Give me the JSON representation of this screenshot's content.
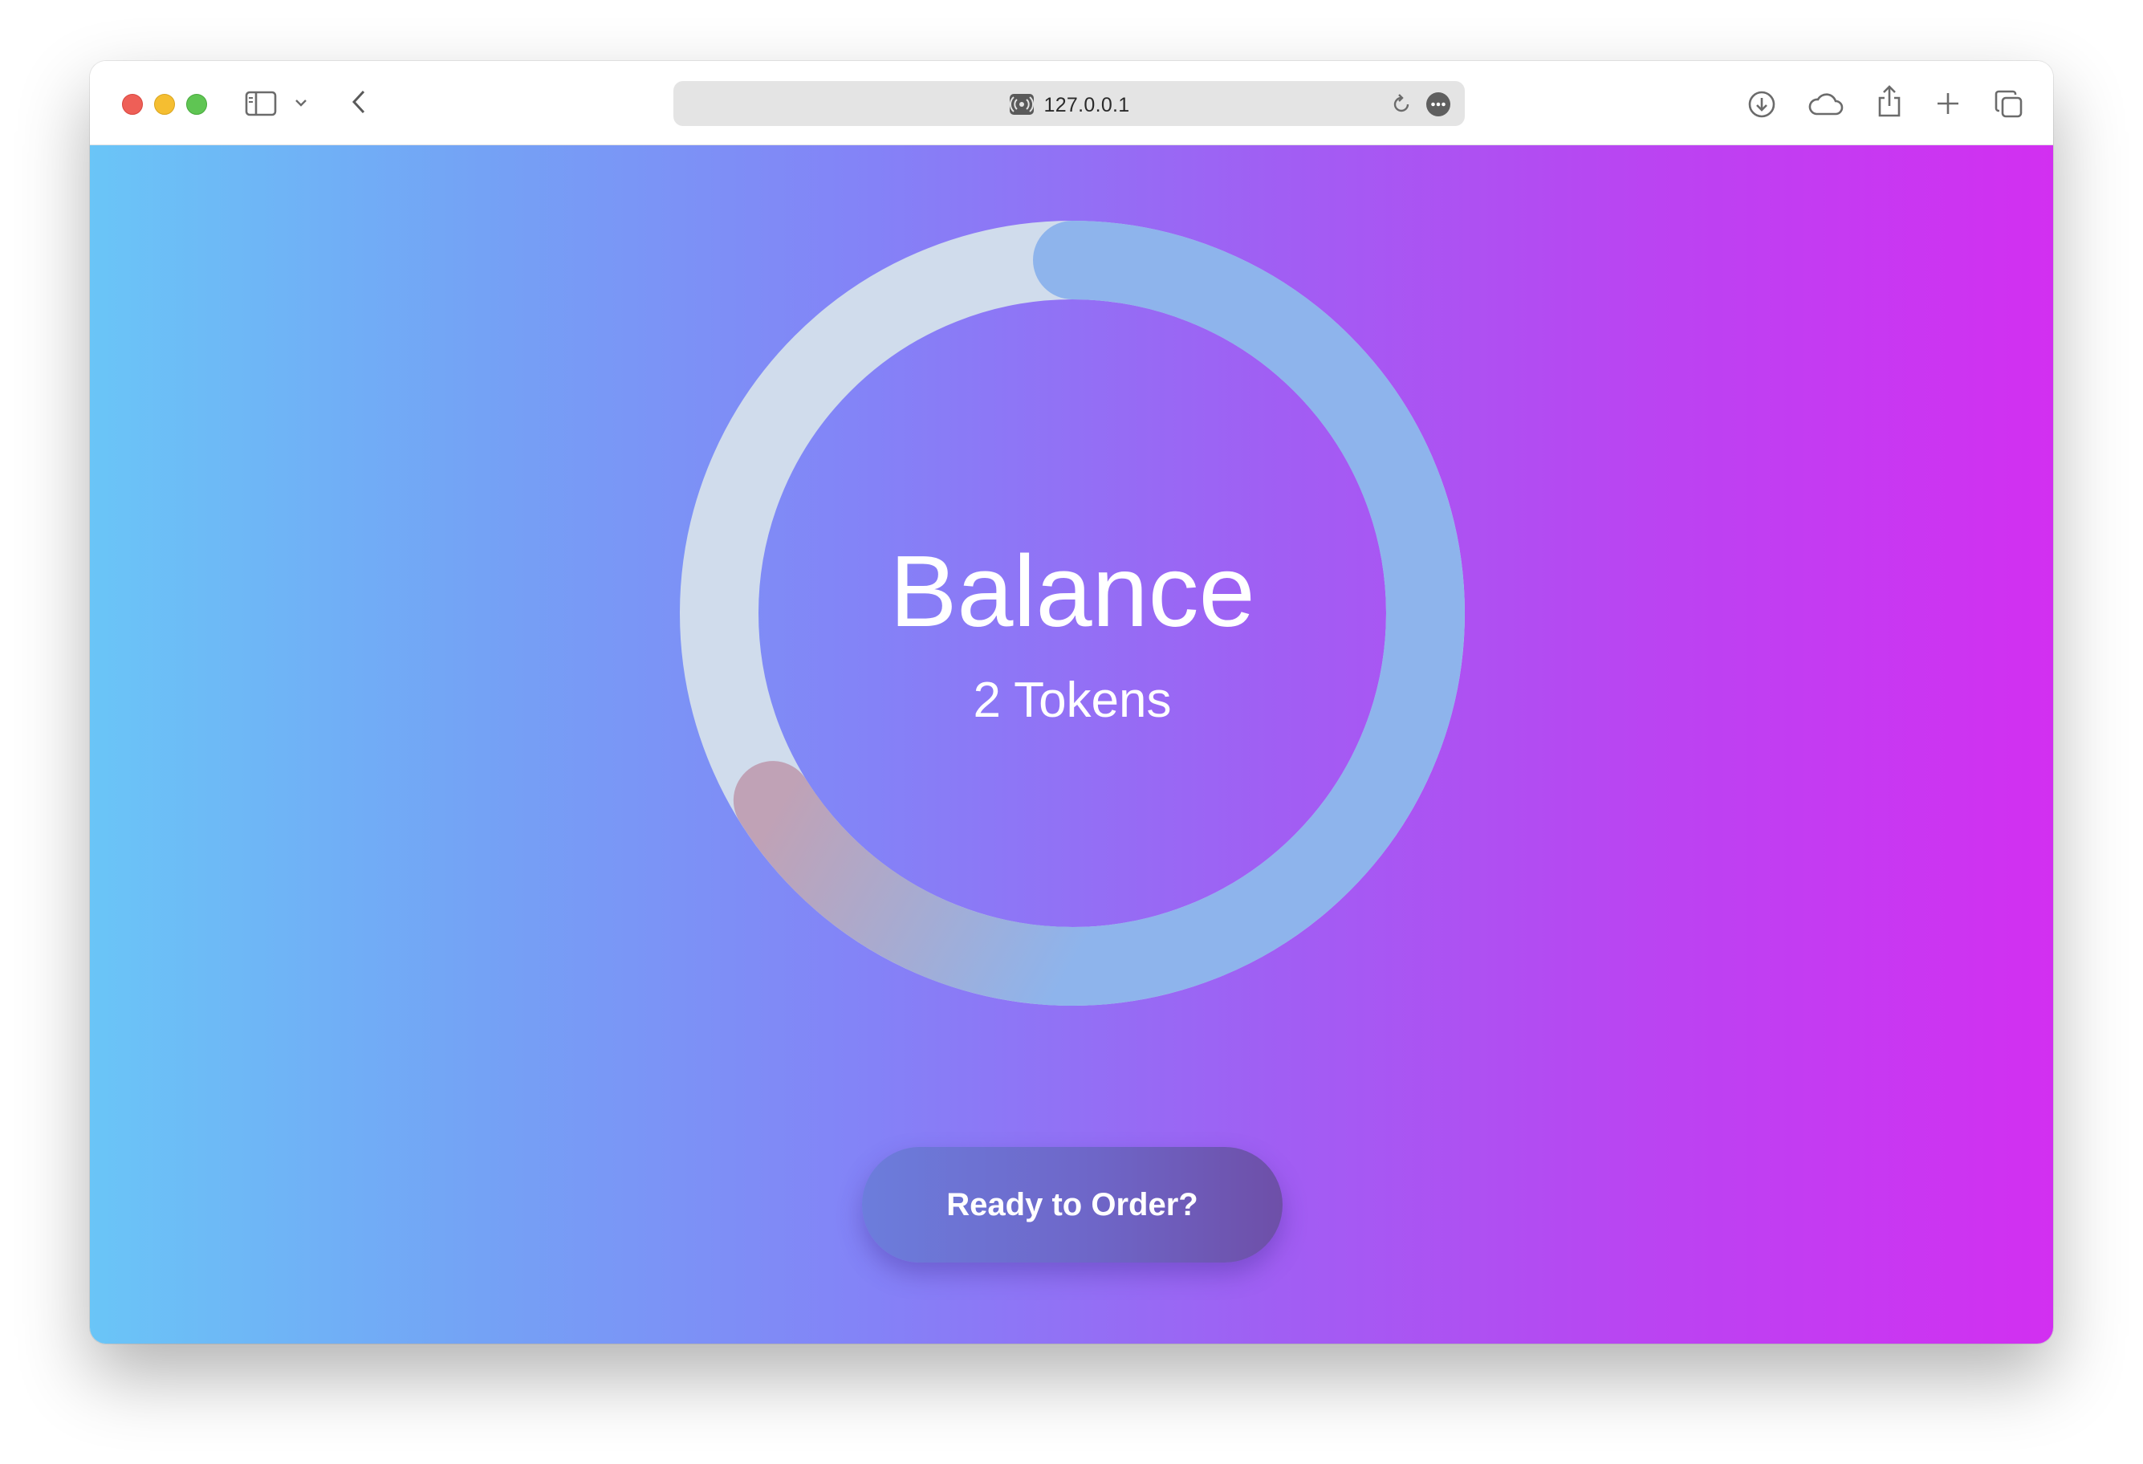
{
  "browser": {
    "url": "127.0.0.1",
    "icons": {
      "close": "close-dot",
      "minimize": "minimize-dot",
      "zoom": "zoom-dot",
      "sidebar": "sidebar-icon",
      "sidebar_menu": "chevron-down-icon",
      "back": "chevron-left-icon",
      "site": "broadcast-icon",
      "reload": "reload-icon",
      "page_menu": "more-icon",
      "downloads": "download-icon",
      "icloud": "cloud-icon",
      "share": "share-icon",
      "new_tab": "plus-icon",
      "tabs": "tabs-overview-icon"
    }
  },
  "balance": {
    "title": "Balance",
    "value": "2 Tokens",
    "ring": {
      "track_color": "#d0dcec",
      "progress_color": "#8eb4ec",
      "tail_color": "#c0a2b6"
    }
  },
  "actions": {
    "order_label": "Ready to Order?"
  },
  "theme": {
    "gradient": [
      "#6ac5f7",
      "#8482f7",
      "#d22ff1"
    ]
  }
}
